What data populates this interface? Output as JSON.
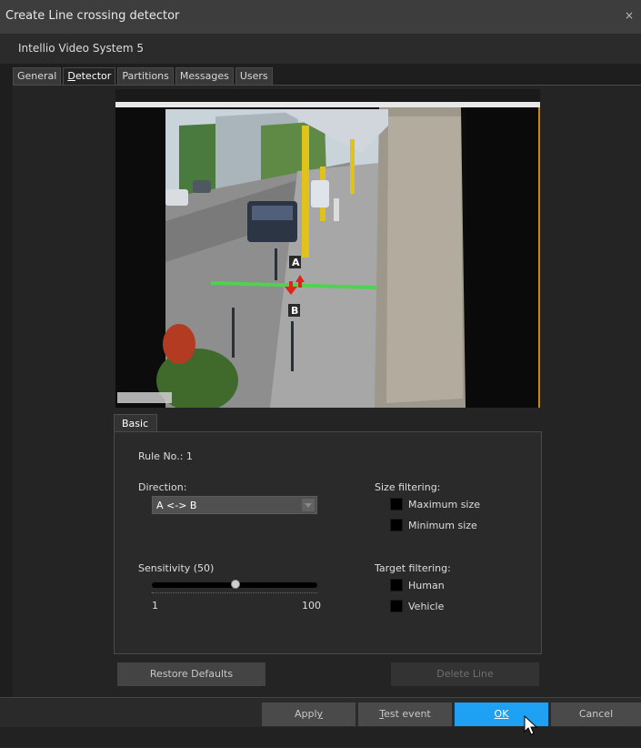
{
  "window": {
    "title": "Create Line crossing detector",
    "close_glyph": "×"
  },
  "subtitle": "Intellio Video System 5",
  "tabs": [
    {
      "label_before": "General",
      "label_ul": "",
      "label_after": "",
      "active": false
    },
    {
      "label_before": "",
      "label_ul": "D",
      "label_after": "etector",
      "active": true
    },
    {
      "label_before": "Partitions",
      "label_ul": "",
      "label_after": "",
      "active": false
    },
    {
      "label_before": "Messages",
      "label_ul": "",
      "label_after": "",
      "active": false
    },
    {
      "label_before": "Users",
      "label_ul": "",
      "label_after": "",
      "active": false
    }
  ],
  "video": {
    "marker_a": "A",
    "marker_b": "B",
    "line_color": "#4fd24f",
    "arrow_color": "#e2231a"
  },
  "basic": {
    "tab_label": "Basic",
    "rule_no": "Rule No.: 1",
    "direction_label": "Direction:",
    "direction_value": "A <-> B",
    "sensitivity_label": "Sensitivity (50)",
    "sensitivity_value": 50,
    "slider_min": "1",
    "slider_max": "100",
    "size_filtering_label": "Size filtering:",
    "maximum_size": "Maximum size",
    "minimum_size": "Minimum size",
    "target_filtering_label": "Target filtering:",
    "human": "Human",
    "vehicle": "Vehicle"
  },
  "buttons": {
    "restore_defaults": "Restore Defaults",
    "delete_line": "Delete Line",
    "apply_before": "Appl",
    "apply_ul": "y",
    "test_ul": "T",
    "test_after": "est event",
    "ok_ul": "O",
    "ok_after": "K",
    "cancel": "Cancel"
  },
  "colors": {
    "accent": "#1ea1f2"
  }
}
